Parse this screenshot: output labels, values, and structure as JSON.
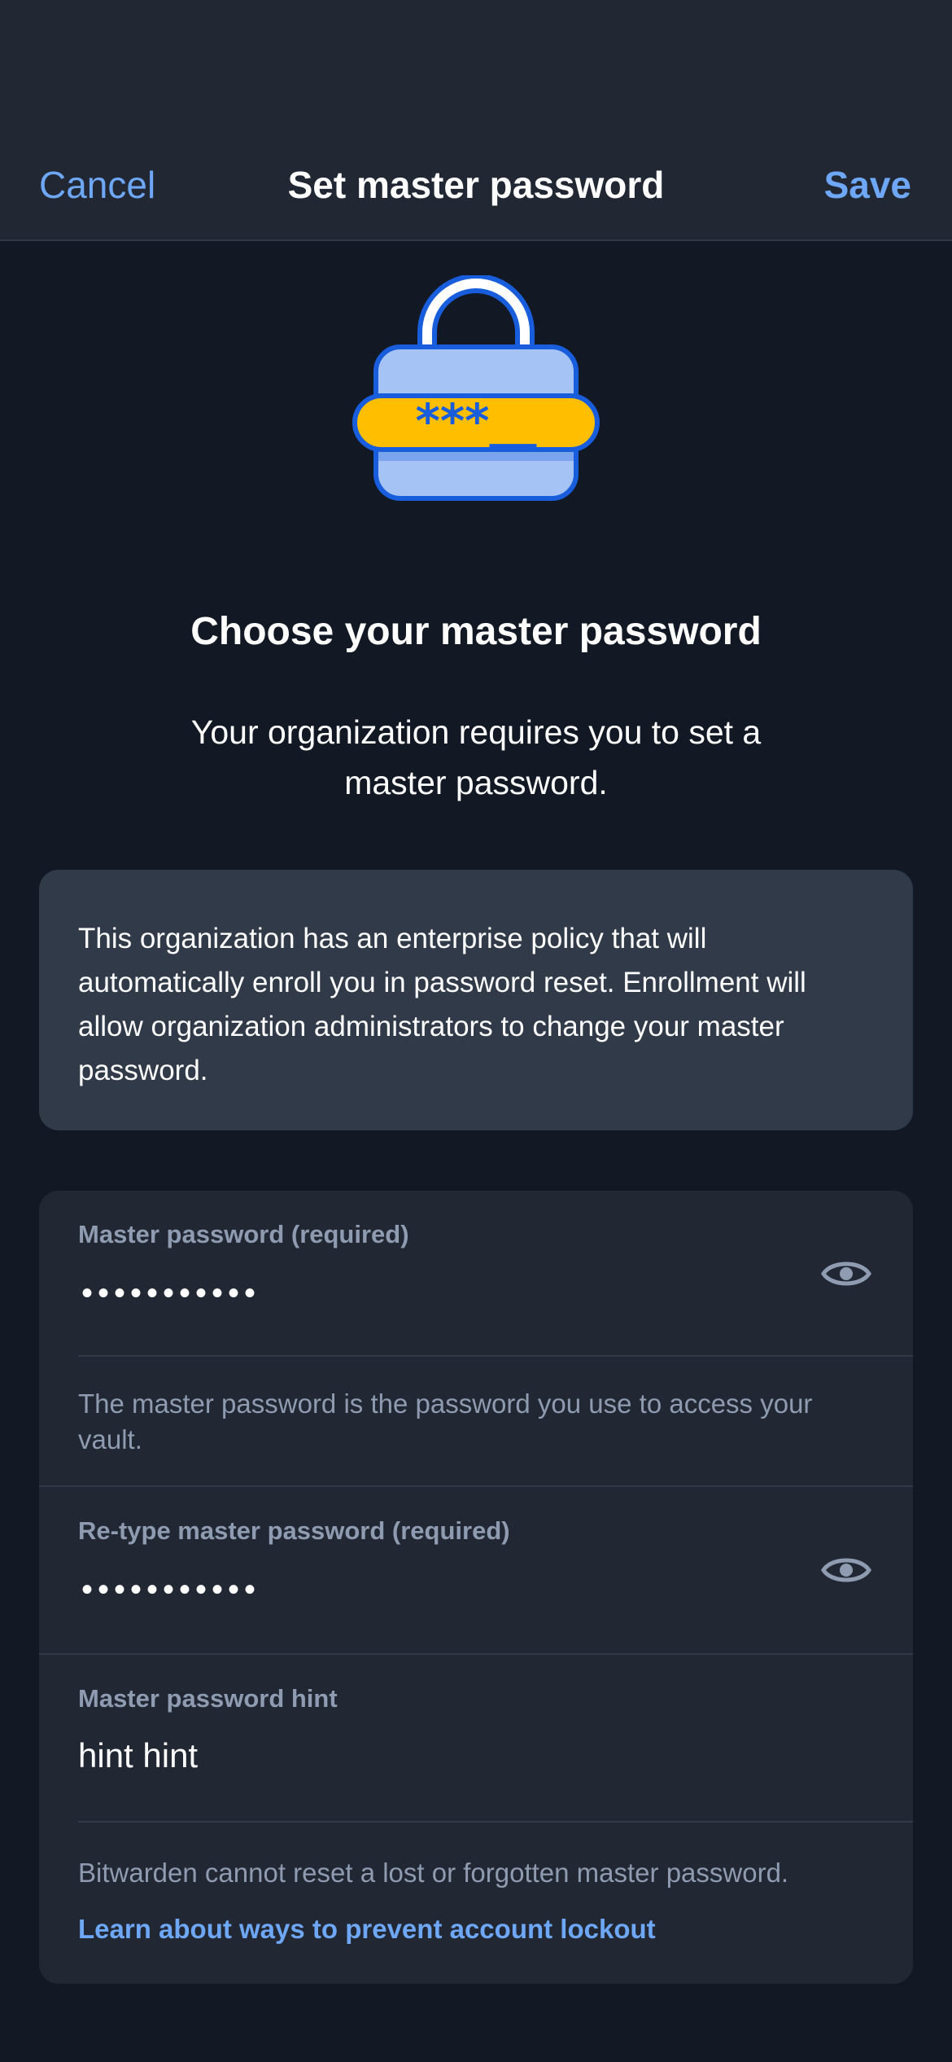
{
  "nav": {
    "cancel_label": "Cancel",
    "title": "Set master password",
    "save_label": "Save"
  },
  "illustration": {
    "icon": "lock-password-icon",
    "text": "***__",
    "colors": {
      "body": "#a5c3f5",
      "outline": "#175ddc",
      "band": "#ffbf00"
    }
  },
  "main": {
    "heading": "Choose your master password",
    "subheading": "Your organization requires you to set a master password."
  },
  "policy_notice": {
    "text": "This organization has an enterprise policy that will automatically enroll you in password reset. Enrollment will allow organization administrators to change your master password."
  },
  "form": {
    "master_password": {
      "label": "Master password (required)",
      "value": "•••••••••••",
      "helper": "The master password is the password you use to access your vault.",
      "toggle_icon": "eye-icon"
    },
    "retype_password": {
      "label": "Re-type master password (required)",
      "value": "•••••••••••",
      "toggle_icon": "eye-icon"
    },
    "hint": {
      "label": "Master password hint",
      "value": "hint hint"
    },
    "footer_text": "Bitwarden cannot reset a lost or forgotten master password.",
    "lockout_link": "Learn about ways to prevent account lockout"
  },
  "colors": {
    "background": "#121925",
    "surface": "#212733",
    "accent": "#6ea7f5",
    "muted_text": "#8e9bb0"
  }
}
